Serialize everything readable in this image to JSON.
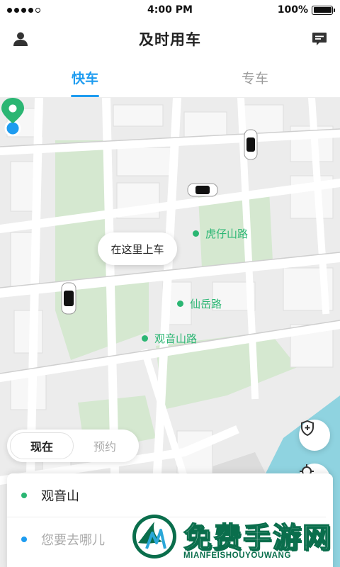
{
  "status_bar": {
    "time": "4:00 PM",
    "battery_text": "100%",
    "battery_level": 1.0,
    "signal_bars_filled": 4,
    "signal_bars_total": 5
  },
  "header": {
    "title": "及时用车",
    "left_icon": "profile-icon",
    "right_icon": "message-icon"
  },
  "tabs": [
    {
      "label": "快车",
      "active": true
    },
    {
      "label": "专车",
      "active": false
    }
  ],
  "map": {
    "pickup_bubble": "在这里上车",
    "labels": [
      {
        "text": "虎仔山路"
      },
      {
        "text": "仙岳路"
      },
      {
        "text": "观音山路"
      }
    ],
    "colors": {
      "road": "#ffffff",
      "block": "#e4e4e4",
      "park": "#d5e8d0",
      "water": "#8fd3e0",
      "label": "#2bb673",
      "accent": "#1e9cf0"
    }
  },
  "mode_toggle": {
    "options": [
      {
        "label": "现在",
        "active": true
      },
      {
        "label": "预约",
        "active": false
      }
    ]
  },
  "address": {
    "from_value": "观音山",
    "to_placeholder": "您要去哪儿"
  },
  "watermark": {
    "title": "免费手游网",
    "subtitle": "MIANFEISHOUYOUWANG"
  }
}
